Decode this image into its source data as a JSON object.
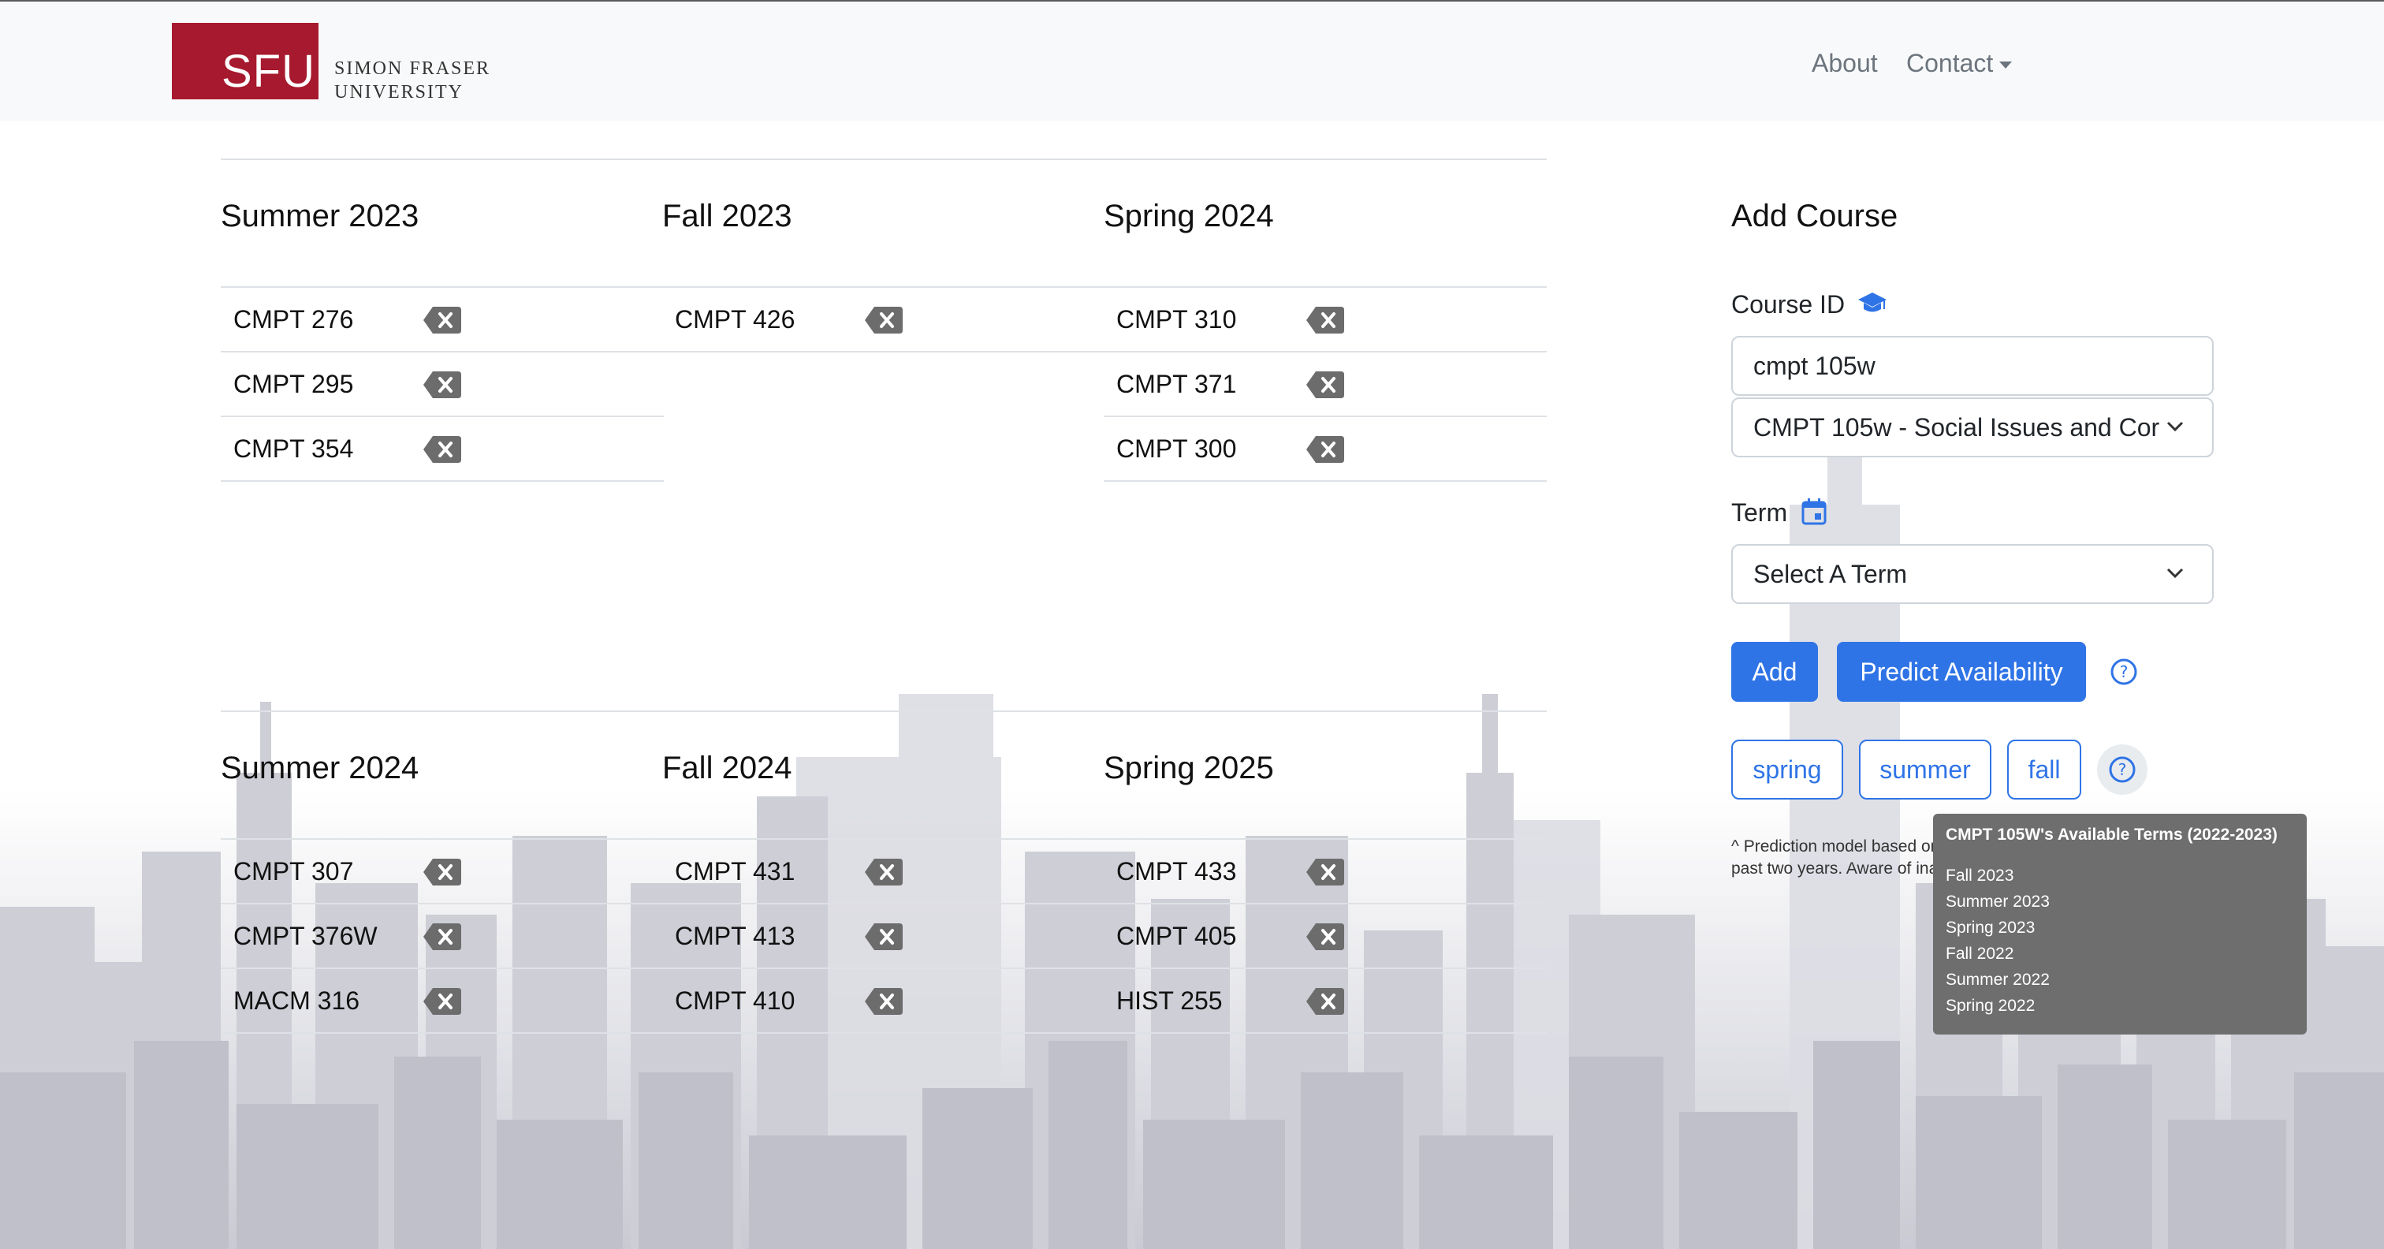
{
  "nav": {
    "logo_text": "SFU",
    "logo_sub_line1": "SIMON FRASER",
    "logo_sub_line2": "UNIVERSITY",
    "links": [
      "About",
      "Contact"
    ]
  },
  "terms": [
    {
      "title": "Summer 2023",
      "courses": [
        "CMPT 276",
        "CMPT 295",
        "CMPT 354"
      ]
    },
    {
      "title": "Fall 2023",
      "courses": [
        "CMPT 426"
      ]
    },
    {
      "title": "Spring 2024",
      "courses": [
        "CMPT 310",
        "CMPT 371",
        "CMPT 300"
      ]
    },
    {
      "title": "Summer 2024",
      "courses": [
        "CMPT 307",
        "CMPT 376W",
        "MACM 316"
      ]
    },
    {
      "title": "Fall 2024",
      "courses": [
        "CMPT 431",
        "CMPT 413",
        "CMPT 410"
      ]
    },
    {
      "title": "Spring 2025",
      "courses": [
        "CMPT 433",
        "CMPT 405",
        "HIST 255"
      ]
    }
  ],
  "add_course": {
    "title": "Add Course",
    "course_id_label": "Course ID",
    "course_id_value": "cmpt 105w",
    "course_select_value": "CMPT 105w - Social Issues and Cor",
    "term_label": "Term",
    "term_select_value": "Select A Term",
    "add_button": "Add",
    "predict_button": "Predict Availability",
    "season_buttons": [
      "spring",
      "summer",
      "fall"
    ],
    "note_line1": "^ Prediction model based on course offering data from",
    "note_line2": "past two years. Aware of inaccuracy."
  },
  "tooltip": {
    "title": "CMPT 105W's Available Terms (2022-2023)",
    "items": [
      "Fall 2023",
      "Summer 2023",
      "Spring 2023",
      "Fall 2022",
      "Summer 2022",
      "Spring 2022"
    ]
  },
  "colors": {
    "brand_red": "#a6192e",
    "primary_blue": "#2f74e6",
    "delete_gray": "#6c6c6c"
  }
}
